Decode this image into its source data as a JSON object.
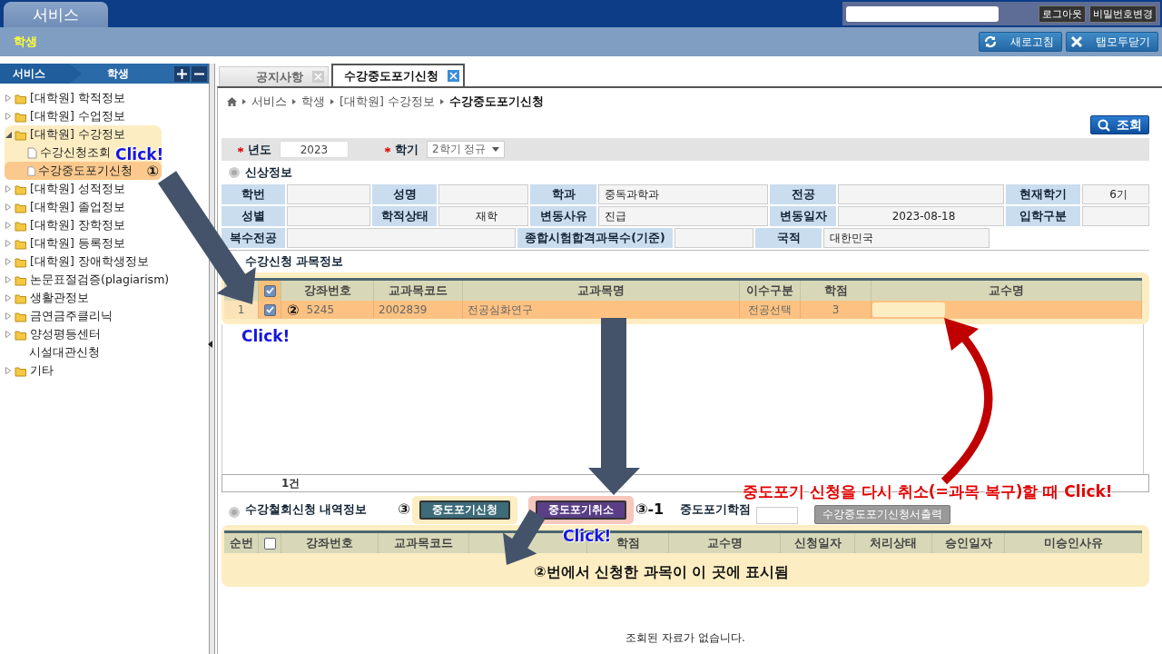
{
  "header": {
    "service_tab": "서비스",
    "buttons": [
      "로그아웃",
      "비밀번호변경"
    ]
  },
  "subheader": {
    "title": "학생",
    "buttons": [
      "새로고침",
      "탭모두닫기"
    ]
  },
  "sidebar": {
    "crumbs": [
      "서비스",
      "학생"
    ],
    "tree": [
      {
        "label": "[대학원] 학적정보",
        "kind": "folder",
        "expanded": false,
        "selected": false
      },
      {
        "label": "[대학원] 수업정보",
        "kind": "folder",
        "expanded": false,
        "selected": false
      },
      {
        "label": "[대학원] 수강정보",
        "kind": "folder",
        "expanded": true,
        "selected": false,
        "children": [
          {
            "label": "수강신청조회",
            "kind": "page",
            "selected": false
          },
          {
            "label": "수강중도포기신청",
            "kind": "page",
            "selected": true,
            "step": "①"
          }
        ]
      },
      {
        "label": "[대학원] 성적정보",
        "kind": "folder",
        "expanded": false,
        "selected": false
      },
      {
        "label": "[대학원] 졸업정보",
        "kind": "folder",
        "expanded": false,
        "selected": false
      },
      {
        "label": "[대학원] 장학정보",
        "kind": "folder",
        "expanded": false,
        "selected": false
      },
      {
        "label": "[대학원] 등록정보",
        "kind": "folder",
        "expanded": false,
        "selected": false
      },
      {
        "label": "[대학원] 장애학생정보",
        "kind": "folder",
        "expanded": false,
        "selected": false
      },
      {
        "label": "논문표절검증(plagiarism)",
        "kind": "folder",
        "expanded": false,
        "selected": false
      },
      {
        "label": "생활관정보",
        "kind": "folder",
        "expanded": false,
        "selected": false
      },
      {
        "label": "금연금주클리닉",
        "kind": "folder",
        "expanded": false,
        "selected": false
      },
      {
        "label": "양성평등센터",
        "kind": "folder",
        "expanded": false,
        "selected": false
      },
      {
        "label": "시설대관신청",
        "kind": "plain",
        "selected": false
      },
      {
        "label": "기타",
        "kind": "folder",
        "expanded": false,
        "selected": false
      }
    ]
  },
  "tabs": [
    {
      "label": "공지사항",
      "selected": false
    },
    {
      "label": "수강중도포기신청",
      "selected": true
    }
  ],
  "breadcrumb": [
    "서비스",
    "학생",
    "[대학원] 수강정보",
    "수강중도포기신청"
  ],
  "search_button": "조회",
  "filters": [
    {
      "label": "년도",
      "value": "2023",
      "kind": "input",
      "required": true
    },
    {
      "label": "학기",
      "value": "2학기 정규",
      "kind": "select",
      "required": true
    }
  ],
  "profile": {
    "title": "신상정보",
    "rows": [
      [
        {
          "label": "학번"
        },
        {
          "label": "성명"
        },
        {
          "label": "학과",
          "value": "중독과학과"
        },
        {
          "label": "전공"
        },
        {
          "label": "현재학기",
          "value": "6기"
        }
      ],
      [
        {
          "label": "성별"
        },
        {
          "label": "학적상태",
          "value": "재학"
        },
        {
          "label": "변동사유",
          "value": "진급"
        },
        {
          "label": "변동일자",
          "value": "2023-08-18"
        },
        {
          "label": "입학구분"
        }
      ],
      [
        {
          "label": "복수전공",
          "colspan": 2
        },
        {
          "label": "종합시험합격과목수(기준)"
        },
        {
          "label": "국적",
          "value": "대한민국"
        }
      ]
    ]
  },
  "courses": {
    "title": "수강신청 과목정보",
    "columns": [
      {
        "kind": "blank"
      },
      {
        "kind": "checkbox",
        "checked": true
      },
      {
        "kind": "text",
        "label": "강좌번호"
      },
      {
        "kind": "text",
        "label": "교과목코드"
      },
      {
        "kind": "text",
        "label": "교과목명"
      },
      {
        "kind": "text",
        "label": "이수구분"
      },
      {
        "kind": "text",
        "label": "학점"
      },
      {
        "kind": "text",
        "label": "교수명"
      }
    ],
    "rows": [
      {
        "selected": true,
        "step": "②",
        "cells": [
          {
            "kind": "number",
            "text": "1"
          },
          {
            "kind": "checkbox",
            "checked": true
          },
          {
            "kind": "text",
            "text": "5245"
          },
          {
            "kind": "text",
            "text": "2002839"
          },
          {
            "kind": "text",
            "text": "전공심화연구"
          },
          {
            "kind": "text",
            "text": "전공선택"
          },
          {
            "kind": "text",
            "text": "3"
          },
          {
            "kind": "redacted"
          }
        ]
      }
    ],
    "footer": "1건"
  },
  "withdrawals": {
    "title": "수강철회신청 내역정보",
    "buttons": [
      {
        "label": "중도포기신청",
        "kind": "apply",
        "step": "③"
      },
      {
        "label": "중도포기취소",
        "kind": "cancel",
        "step": "③-1"
      }
    ],
    "credit_label": "중도포기학점",
    "print_button": "수강중도포기신청서출력",
    "columns": [
      {
        "kind": "text",
        "label": "순번"
      },
      {
        "kind": "checkbox",
        "checked": false
      },
      {
        "kind": "text",
        "label": "강좌번호"
      },
      {
        "kind": "text",
        "label": "교과목코드"
      },
      {
        "kind": "blank"
      },
      {
        "kind": "text",
        "label": "학점"
      },
      {
        "kind": "text",
        "label": "교수명"
      },
      {
        "kind": "text",
        "label": "신청일자"
      },
      {
        "kind": "text",
        "label": "처리상태"
      },
      {
        "kind": "text",
        "label": "승인일자"
      },
      {
        "kind": "text",
        "label": "미승인사유"
      }
    ]
  },
  "empty_message": "조회된 자료가 없습니다.",
  "annotations": [
    {
      "kind": "click",
      "text": "Click!"
    },
    {
      "kind": "click",
      "text": "Click!"
    },
    {
      "kind": "click",
      "text": "Click!"
    },
    {
      "kind": "alert",
      "text": "중도포기 신청을 다시 취소(=과목 복구)할 때 Click!"
    },
    {
      "kind": "note",
      "text": "②번에서 신청한 과목이 이 곳에 표시됨"
    }
  ]
}
